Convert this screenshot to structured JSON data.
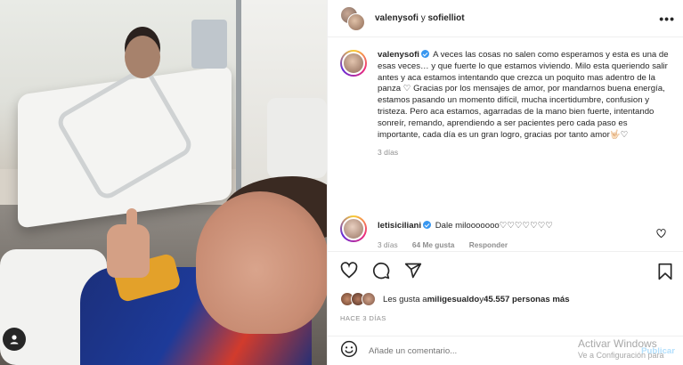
{
  "header": {
    "user1": "valenysofi",
    "connector": " y ",
    "user2": "sofielliot",
    "more_icon": "more-horizontal-icon"
  },
  "caption": {
    "username": "valenysofi",
    "text": "A veces las cosas no salen como esperamos y esta es una de esas veces… y que fuerte lo que estamos viviendo. Milo esta queriendo salir antes y aca estamos intentando que crezca un poquito mas adentro de la panza ♡ Gracias por los mensajes de amor, por mandarnos buena energía, estamos pasando un momento difícil, mucha incertidumbre, confusion y tristeza. Pero aca estamos, agarradas de la mano bien fuerte, intentando sonreír, remando, aprendiendo a ser pacientes pero cada paso es importante, cada día es un gran logro, gracias por tanto amor🤟🏻♡",
    "time": "3 días"
  },
  "comment": {
    "username": "letisiciliani",
    "text": "Dale milooooooo♡♡♡♡♡♡♡",
    "time": "3 días",
    "likes": "64 Me gusta",
    "reply": "Responder"
  },
  "likes": {
    "prefix": "Les gusta a ",
    "user": "miligesualdo",
    "middle": " y ",
    "count": "45.557 personas más"
  },
  "date": "HACE 3 DÍAS",
  "add_comment": {
    "placeholder": "Añade un comentario...",
    "publish": "Publicar"
  },
  "watermark": {
    "line1": "Activar Windows",
    "line2": "Ve a Configuración para"
  },
  "colors": {
    "verified": "#3897f0",
    "muted": "#8e8e8e",
    "publish": "#b2dffc"
  }
}
